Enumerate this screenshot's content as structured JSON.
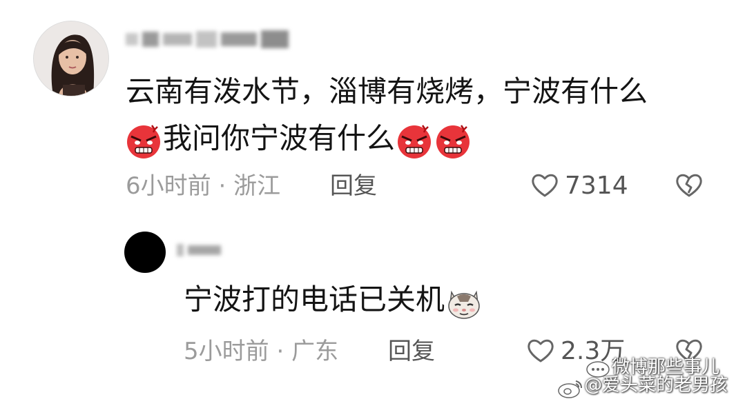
{
  "comments": [
    {
      "text_line1": "云南有泼水节，淄博有烧烤，宁波有什么",
      "text_line2": "我问你宁波有什么",
      "time": "6小时前",
      "separator": "·",
      "location": "浙江",
      "reply_label": "回复",
      "likes": "7314",
      "emoji": "angry-face"
    },
    {
      "text": "宁波打的电话已关机",
      "time": "5小时前",
      "separator": "·",
      "location": "广东",
      "reply_label": "回复",
      "likes": "2.3万",
      "emoji": "cat-face"
    }
  ],
  "watermark": {
    "line1": "微博那些事儿",
    "line2": "@爱头菜的老男孩"
  },
  "colors": {
    "text": "#141414",
    "meta": "#9b9b9b",
    "icon": "#666666",
    "emoji_red": "#e8343a"
  }
}
